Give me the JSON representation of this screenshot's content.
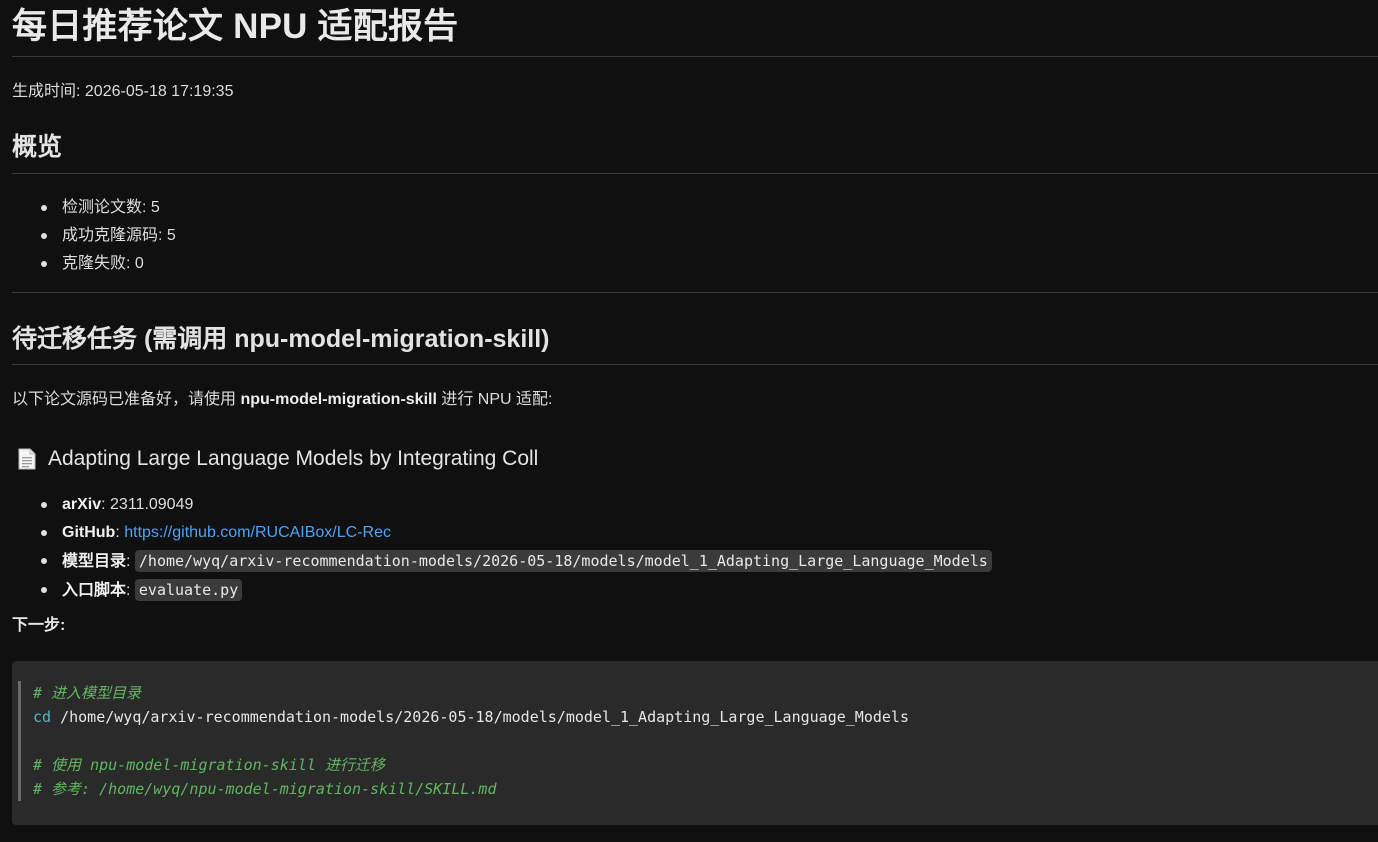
{
  "page": {
    "title": "每日推荐论文 NPU 适配报告",
    "generated": "生成时间: 2026-05-18 17:19:35"
  },
  "overview": {
    "heading": "概览",
    "items": [
      "检测论文数: 5",
      "成功克隆源码: 5",
      "克隆失败: 0"
    ]
  },
  "pending": {
    "heading": "待迁移任务 (需调用 npu-model-migration-skill)",
    "intro_prefix": "以下论文源码已准备好，请使用 ",
    "intro_bold": "npu-model-migration-skill",
    "intro_suffix": " 进行 NPU 适配:",
    "paper": {
      "icon": "document-icon",
      "title": "Adapting Large Language Models by Integrating Coll",
      "arxiv_label": "arXiv",
      "arxiv_value": "2311.09049",
      "github_label": "GitHub",
      "github_url": "https://github.com/RUCAIBox/LC-Rec",
      "model_dir_label": "模型目录",
      "model_dir_value": "/home/wyq/arxiv-recommendation-models/2026-05-18/models/model_1_Adapting_Large_Language_Models",
      "entry_label": "入口脚本",
      "entry_value": "evaluate.py"
    },
    "next_step": "下一步:",
    "code": {
      "comment1": "# 进入模型目录",
      "cmd": "cd",
      "cmd_arg": " /home/wyq/arxiv-recommendation-models/2026-05-18/models/model_1_Adapting_Large_Language_Models",
      "comment2": "# 使用 npu-model-migration-skill 进行迁移",
      "comment3": "# 参考: /home/wyq/npu-model-migration-skill/SKILL.md"
    }
  },
  "colors": {
    "background": "#101010",
    "link": "#4ea3f5",
    "code_comment": "#5fb85f",
    "code_cmd": "#56b6c2"
  }
}
